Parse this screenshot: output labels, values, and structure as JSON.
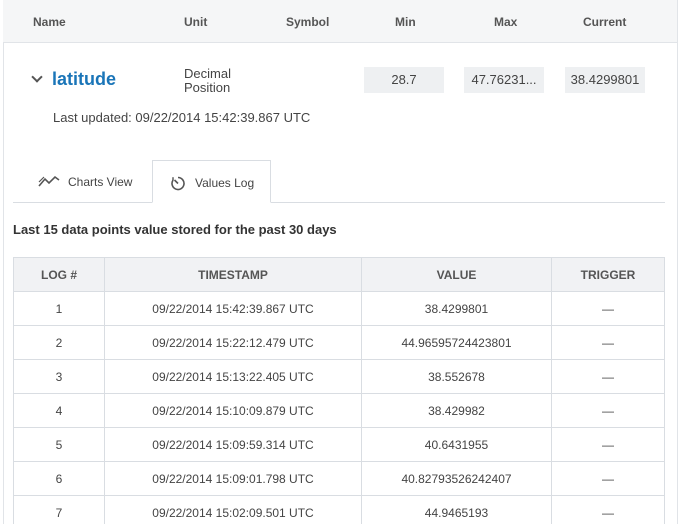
{
  "columns": {
    "name": "Name",
    "unit": "Unit",
    "symbol": "Symbol",
    "min": "Min",
    "max": "Max",
    "current": "Current"
  },
  "property": {
    "name": "latitude",
    "unit_line1": "Decimal",
    "unit_line2": "Position",
    "min": "28.7",
    "max": "47.76231...",
    "current": "38.4299801",
    "last_updated": "Last updated: 09/22/2014 15:42:39.867 UTC"
  },
  "tabs": [
    {
      "label": "Charts View",
      "icon": "line-chart-icon",
      "active": false
    },
    {
      "label": "Values Log",
      "icon": "timer-icon",
      "active": true
    }
  ],
  "section_title": "Last 15 data points value stored for the past 30 days",
  "log_table": {
    "headers": [
      "LOG #",
      "TIMESTAMP",
      "VALUE",
      "TRIGGER"
    ],
    "rows": [
      {
        "log": "1",
        "timestamp": "09/22/2014 15:42:39.867 UTC",
        "value": "38.4299801",
        "trigger": "—"
      },
      {
        "log": "2",
        "timestamp": "09/22/2014 15:22:12.479 UTC",
        "value": "44.96595724423801",
        "trigger": "—"
      },
      {
        "log": "3",
        "timestamp": "09/22/2014 15:13:22.405 UTC",
        "value": "38.552678",
        "trigger": "—"
      },
      {
        "log": "4",
        "timestamp": "09/22/2014 15:10:09.879 UTC",
        "value": "38.429982",
        "trigger": "—"
      },
      {
        "log": "5",
        "timestamp": "09/22/2014 15:09:59.314 UTC",
        "value": "40.6431955",
        "trigger": "—"
      },
      {
        "log": "6",
        "timestamp": "09/22/2014 15:09:01.798 UTC",
        "value": "40.82793526242407",
        "trigger": "—"
      },
      {
        "log": "7",
        "timestamp": "09/22/2014 15:02:09.501 UTC",
        "value": "44.9465193",
        "trigger": "—"
      }
    ]
  },
  "colors": {
    "accent": "#1a75b8",
    "header_bg": "#f5f6f7",
    "value_box_bg": "#eef0f2",
    "border": "#d9dde2"
  }
}
